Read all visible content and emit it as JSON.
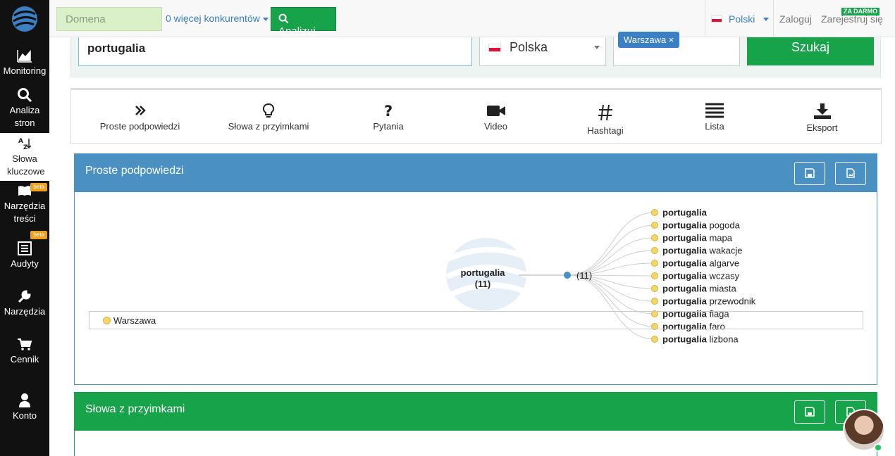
{
  "sidebar": {
    "items": [
      {
        "label": "Monitoring",
        "icon": "chart-icon"
      },
      {
        "label": "Analiza stron",
        "icon": "search-icon"
      },
      {
        "label": "Słowa kluczowe",
        "icon": "az-icon"
      },
      {
        "label": "Narzędzia treści",
        "icon": "book-icon",
        "badge": "beta"
      },
      {
        "label": "Audyty",
        "icon": "list-icon",
        "badge": "beta"
      },
      {
        "label": "Narzędzia",
        "icon": "wrench-icon"
      },
      {
        "label": "Cennik",
        "icon": "cart-icon"
      },
      {
        "label": "Konto",
        "icon": "user-icon"
      }
    ]
  },
  "topbar": {
    "domain_placeholder": "Domena",
    "competitors": "0 więcej konkurentów",
    "analyze": "Analizuj",
    "language": "Polski",
    "login": "Zaloguj",
    "register": "Zarejestruj się",
    "free_badge": "ZA DARMO"
  },
  "search": {
    "keyword": "portugalia",
    "country": "Polska",
    "city_tag": "Warszawa ×",
    "button": "Szukaj"
  },
  "tabs": [
    {
      "label": "Proste podpowiedzi",
      "icon": "double-chevron-icon"
    },
    {
      "label": "Słowa z przyimkami",
      "icon": "lightbulb-icon"
    },
    {
      "label": "Pytania",
      "icon": "question-icon"
    },
    {
      "label": "Video",
      "icon": "video-icon"
    },
    {
      "label": "Hashtagi",
      "icon": "hashtag-icon"
    },
    {
      "label": "Lista",
      "icon": "list-icon"
    },
    {
      "label": "Eksport",
      "icon": "download-icon"
    }
  ],
  "panel1": {
    "title": "Proste podpowiedzi",
    "root": "portugalia",
    "root_count": "(11)",
    "node_count": "(11)",
    "legend": "Warszawa",
    "suggestions": [
      {
        "bold": "portugalia",
        "rest": ""
      },
      {
        "bold": "portugalia",
        "rest": " pogoda"
      },
      {
        "bold": "portugalia",
        "rest": " mapa"
      },
      {
        "bold": "portugalia",
        "rest": " wakacje"
      },
      {
        "bold": "portugalia",
        "rest": " algarve"
      },
      {
        "bold": "portugalia",
        "rest": " wczasy"
      },
      {
        "bold": "portugalia",
        "rest": " miasta"
      },
      {
        "bold": "portugalia",
        "rest": " przewodnik"
      },
      {
        "bold": "portugalia",
        "rest": " flaga"
      },
      {
        "bold": "portugalia",
        "rest": " faro"
      },
      {
        "bold": "portugalia",
        "rest": " lizbona"
      }
    ]
  },
  "panel2": {
    "title": "Słowa z przyimkami"
  },
  "colors": {
    "blue": "#4a90c2",
    "green": "#16a34a",
    "sidebar": "#111111"
  }
}
